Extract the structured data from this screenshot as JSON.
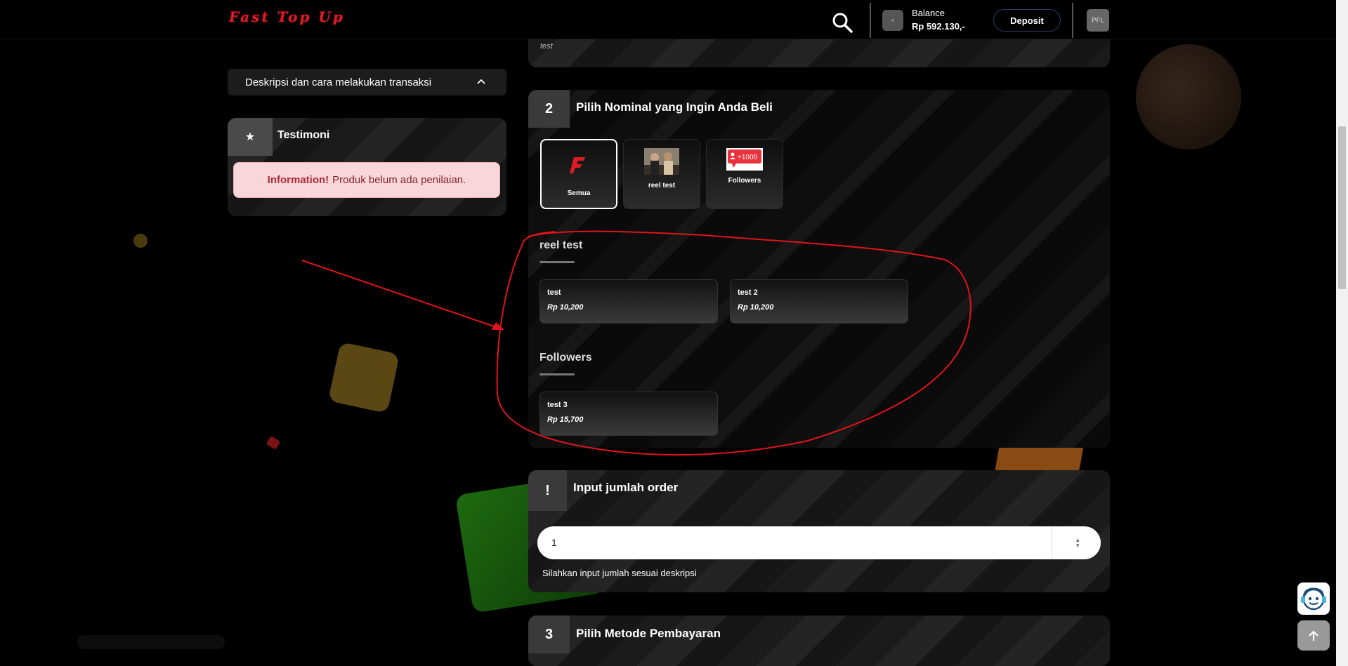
{
  "header": {
    "logo_text": "Fast Top Up",
    "balance_label": "Balance",
    "balance_value": "Rp 592.130,-",
    "deposit_label": "Deposit",
    "profile_initials": "PFL",
    "icons": [
      "search-icon"
    ]
  },
  "top_card": {
    "note": "test"
  },
  "sidebar": {
    "description_label": "Deskripsi dan cara melakukan transaksi",
    "testimonial_title": "Testimoni",
    "alert_strong": "Information!",
    "alert_text": "Produk belum ada penilaian."
  },
  "step2": {
    "number": "2",
    "title": "Pilih Nominal yang Ingin Anda Beli",
    "categories": [
      {
        "label": "Semua",
        "active": true
      },
      {
        "label": "reel test",
        "active": false
      },
      {
        "label": "Followers",
        "badge": "+1000",
        "active": false
      }
    ],
    "sections": [
      {
        "title": "reel test",
        "products": [
          {
            "name": "test",
            "price": "Rp 10,200"
          },
          {
            "name": "test 2",
            "price": "Rp 10,200"
          }
        ]
      },
      {
        "title": "Followers",
        "products": [
          {
            "name": "test 3",
            "price": "Rp 15,700"
          }
        ]
      }
    ]
  },
  "order": {
    "number": "!",
    "title": "Input jumlah order",
    "value": "1",
    "hint": "Silahkan input jumlah sesuai deskripsi"
  },
  "step3": {
    "number": "3",
    "title": "Pilih Metode Pembayaran"
  },
  "colors": {
    "brand_red": "#e01b24",
    "annotation_red": "#e0141b",
    "alert_bg": "#f8d7da"
  }
}
